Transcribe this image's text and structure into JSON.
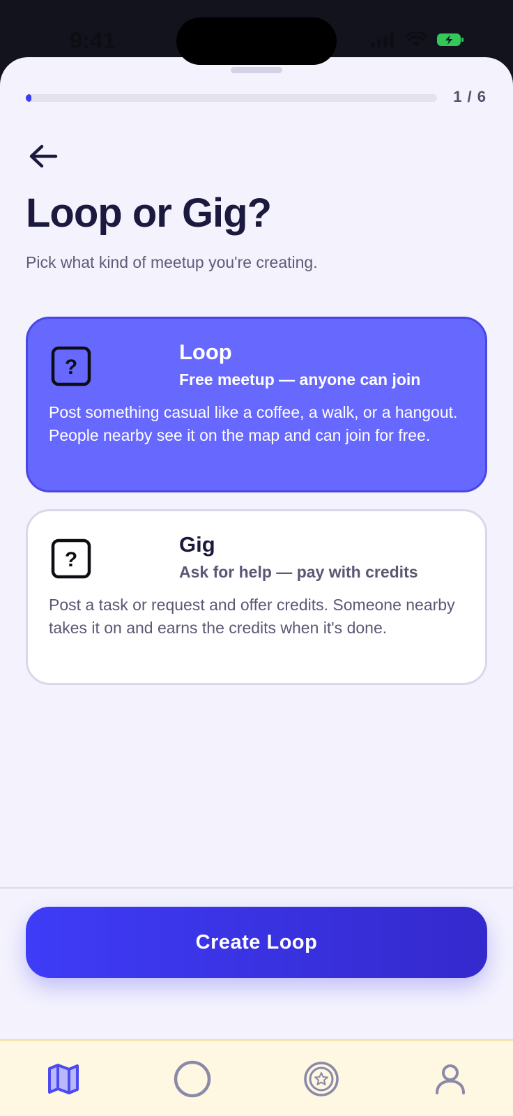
{
  "status": {
    "time": "9:41",
    "battery_color": "#34c759"
  },
  "progress": {
    "label": "1 / 6",
    "current": 1,
    "total": 6
  },
  "header": {
    "back_icon": "arrow-left-icon",
    "title": "Loop or Gig?",
    "subtitle": "Pick what kind of meetup you're creating."
  },
  "options": [
    {
      "icon": "question-box-icon",
      "title": "Loop",
      "subtitle": "Free meetup — anyone can join",
      "description": "Post something casual like a coffee, a walk, or a hangout. People nearby see it on the map and can join for free.",
      "selected": true
    },
    {
      "icon": "question-box-icon",
      "title": "Gig",
      "subtitle": "Ask for help — pay with credits",
      "description": "Post a task or request and offer credits. Someone nearby takes it on and earns the credits when it's done.",
      "selected": false
    }
  ],
  "cta": {
    "label": "Create Loop"
  },
  "tabbar": {
    "tabs": [
      {
        "icon": "map-icon",
        "active": true
      },
      {
        "icon": "circle-icon",
        "active": false
      },
      {
        "icon": "badge-star-icon",
        "active": false
      },
      {
        "icon": "person-icon",
        "active": false
      }
    ]
  },
  "colors": {
    "accent": "#3d3af4",
    "selected_card": "#6768fe",
    "title": "#1b1a3e",
    "background": "#f3f2fd",
    "tabbar": "#fef7e2"
  }
}
